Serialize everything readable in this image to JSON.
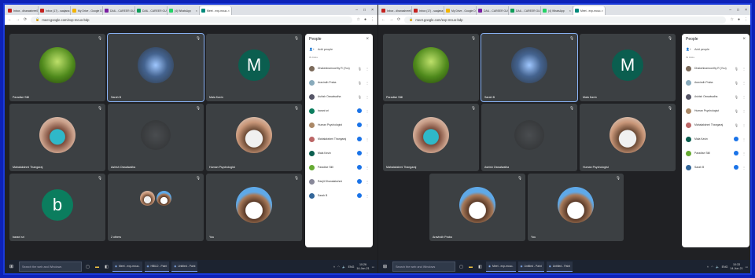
{
  "colors": {
    "outer_bg": "#0d22b8",
    "meet_bg": "#202124",
    "tile_bg": "#3c4043",
    "red": "#ea4335",
    "blue": "#1a73e8"
  },
  "browser": {
    "tabs": [
      {
        "label": "Inbox - dhanashree09",
        "color": "#c5221f"
      },
      {
        "label": "Inbox (17) - saajana",
        "color": "#c5221f"
      },
      {
        "label": "My Drive - Google D",
        "color": "#f4b400"
      },
      {
        "label": "DAIL - CAREER GUID",
        "color": "#7b1fa2"
      },
      {
        "label": "DAIL - CAREER GUID",
        "color": "#0f9d58"
      },
      {
        "label": "(4) WhatsApp",
        "color": "#25d366"
      },
      {
        "label": "Meet - exp-mcuo-",
        "color": "#00897b"
      }
    ],
    "url": "meet.google.com/exp-mcuo-bdp"
  },
  "left": {
    "tiles": [
      {
        "name": "Paradise Still",
        "avatar": "wheat"
      },
      {
        "name": "Sarah B",
        "avatar": "flowers"
      },
      {
        "name": "Mala Kavin",
        "avatar": "letter",
        "letter": "M",
        "color": "#0b5e4f"
      },
      {
        "name": "Mahalakshmi Thangaraj",
        "avatar": "photo1"
      },
      {
        "name": "Ashish Oswalwalha",
        "avatar": "dark"
      },
      {
        "name": "Human Psychologist",
        "avatar": "photo2"
      },
      {
        "name": "barani sri",
        "avatar": "letter",
        "letter": "b",
        "color": "#0b7d5e"
      },
      {
        "name": "2 others",
        "avatar": "pair"
      },
      {
        "name": "You",
        "avatar": "photo3"
      }
    ],
    "people": [
      {
        "name": "Dhakshinamoorthy R (You)",
        "color": "#7b6a5a"
      },
      {
        "name": "Aravindh Praba",
        "color": "#8ab"
      },
      {
        "name": "Ashish Oswalwalha",
        "color": "#556"
      },
      {
        "name": "barani sri",
        "color": "#0b7d5e"
      },
      {
        "name": "Human Psychologist",
        "color": "#a86"
      },
      {
        "name": "Mahalakshmi Thangaraj",
        "color": "#b66"
      },
      {
        "name": "Mala Kavin",
        "color": "#0b5e4f"
      },
      {
        "name": "Paradise Still",
        "color": "#6a3"
      },
      {
        "name": "Ranjit Dhanalakshmi",
        "color": "#889"
      },
      {
        "name": "Sarah B",
        "color": "#369"
      }
    ]
  },
  "right": {
    "tiles": [
      {
        "name": "Paradise Still",
        "avatar": "wheat"
      },
      {
        "name": "Sarah B",
        "avatar": "flowers"
      },
      {
        "name": "Mala Kavin",
        "avatar": "letter",
        "letter": "M",
        "color": "#0b5e4f"
      },
      {
        "name": "Mahalakshmi Thangaraj",
        "avatar": "photo1"
      },
      {
        "name": "Ashish Oswalwalha",
        "avatar": "dark"
      },
      {
        "name": "Human Psychologist",
        "avatar": "photo2"
      },
      {
        "name": "Aravindh Praba",
        "avatar": "photo3"
      },
      {
        "name": "You",
        "avatar": "photo3"
      }
    ],
    "people": [
      {
        "name": "Dhakshinamoorthy R (You)",
        "color": "#7b6a5a"
      },
      {
        "name": "Aravindh Praba",
        "color": "#8ab"
      },
      {
        "name": "Ashish Oswalwalha",
        "color": "#556"
      },
      {
        "name": "Human Psychologist",
        "color": "#a86"
      },
      {
        "name": "Mahalakshmi Thangaraj",
        "color": "#b66"
      },
      {
        "name": "Mala Kavin",
        "color": "#0b5e4f"
      },
      {
        "name": "Paradise Still",
        "color": "#6a3"
      },
      {
        "name": "Sarah B",
        "color": "#369"
      }
    ]
  },
  "panel": {
    "title": "People",
    "add_label": "Add people",
    "section": "IN CALL"
  },
  "meetbar": {
    "left_info": "10:26 | exp-mcuo-bdp",
    "right_info": "10:33 | exp-mcuo-bdp"
  },
  "taskbar": {
    "search_placeholder": "Search the web and Windows",
    "left_apps": [
      "Meet - exp-mcuo-",
      "HBILD - Paint",
      "Untitled - Paint"
    ],
    "right_apps": [
      "Meet - exp-mcuo-",
      "Untitled - Paint",
      "Untitled - Paint"
    ],
    "lang": "ENG",
    "left_time": "10:26",
    "left_date": "14-Jun-21",
    "right_time": "10:33",
    "right_date": "14-Jun-21"
  }
}
